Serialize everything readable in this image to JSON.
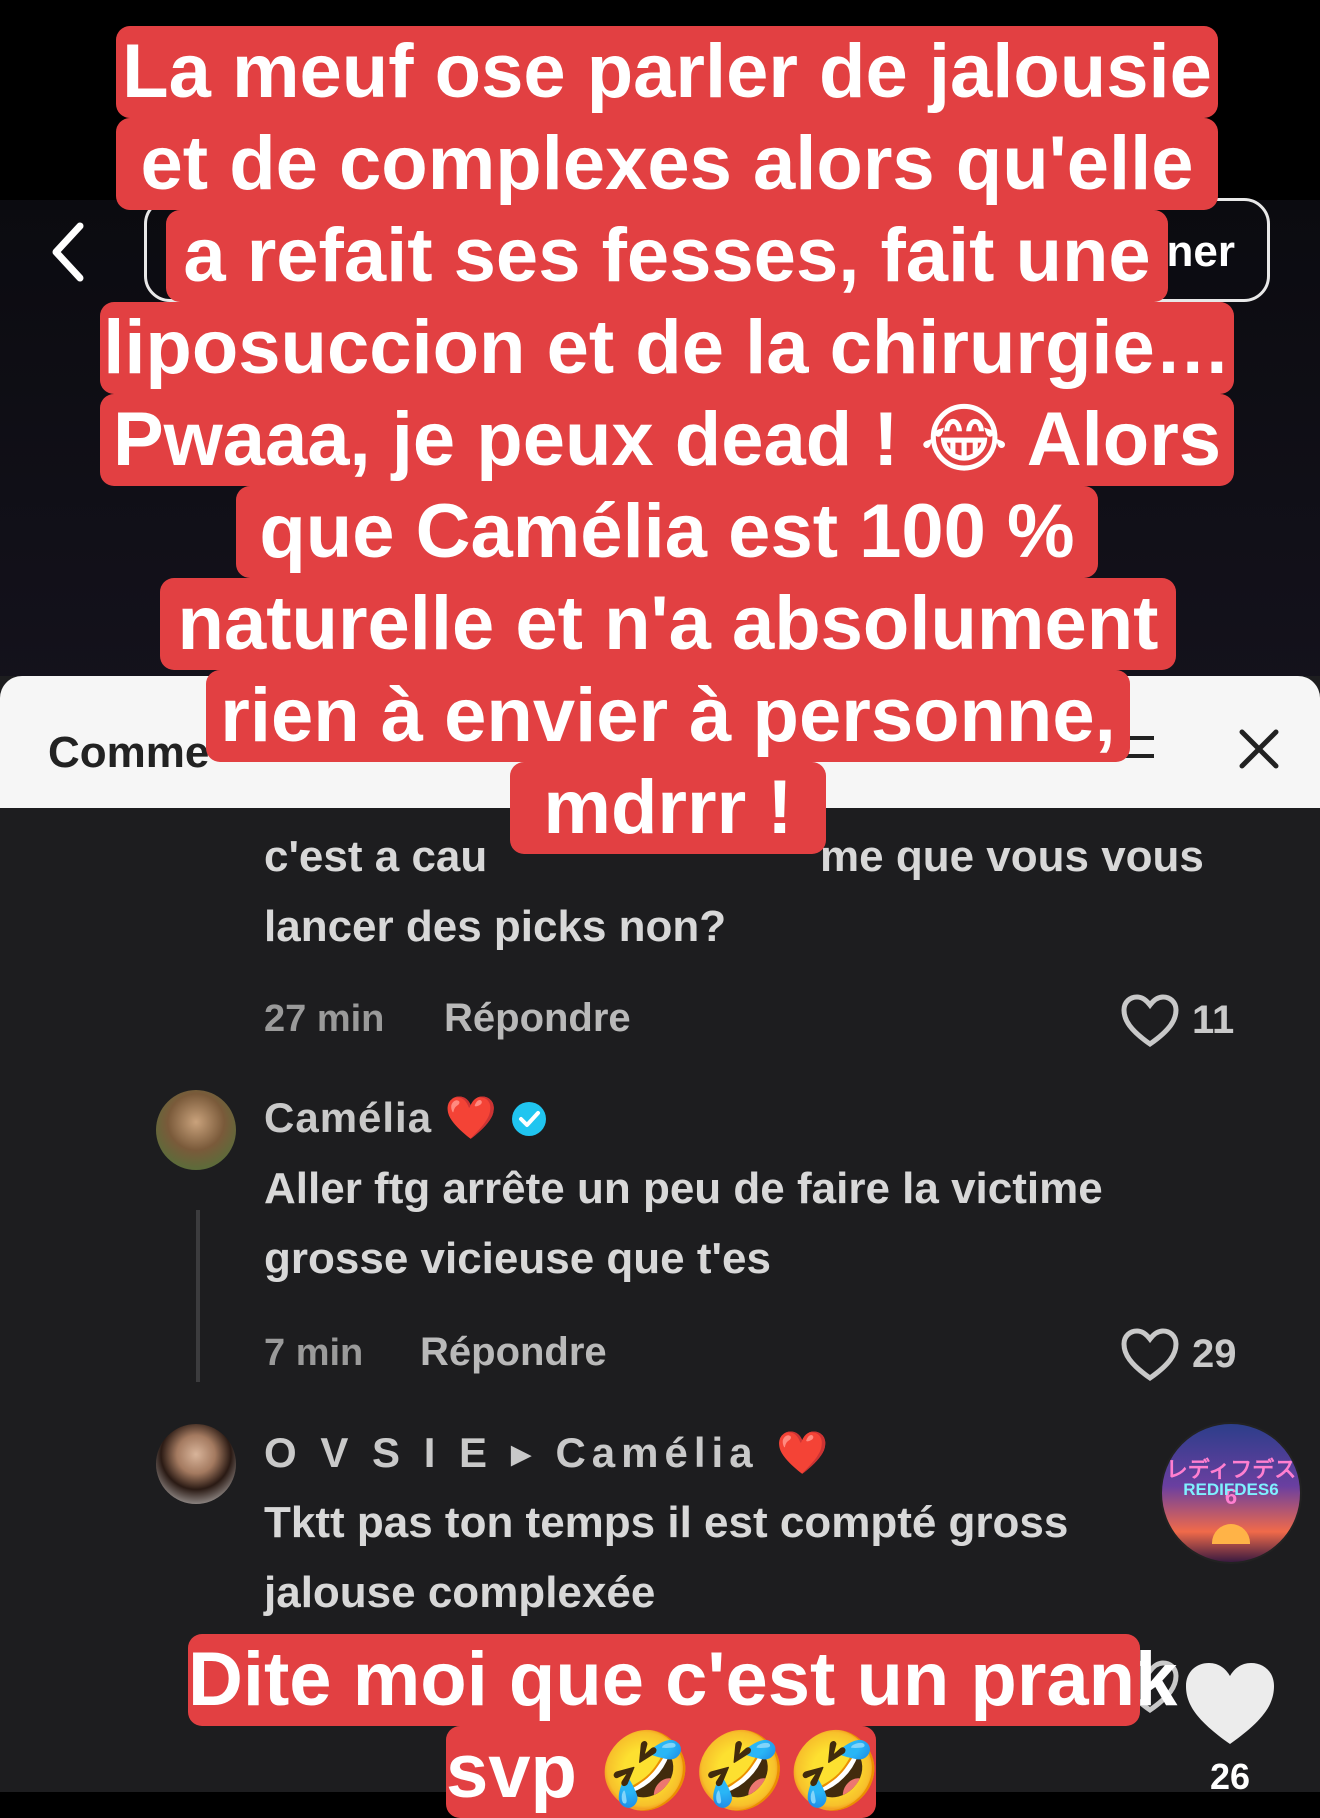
{
  "top_bar": {
    "pill_text": "ner"
  },
  "comments_sheet": {
    "title": "Comme",
    "comments": [
      {
        "text_lines": [
          "c'est a cau",
          "me que vous vous",
          "lancer des picks non?"
        ],
        "time": "27 min",
        "reply_label": "Répondre",
        "likes": "11"
      },
      {
        "username": "Camélia ❤️",
        "text_lines": [
          "Aller ftg arrête un peu de faire la victime",
          "grosse vicieuse que t'es"
        ],
        "time": "7 min",
        "reply_label": "Répondre",
        "likes": "29"
      },
      {
        "username": "O V S I E ▸ Camélia ❤️",
        "text_lines": [
          "Tktt pas ton temps il est compté gross",
          "jalouse complexée"
        ]
      }
    ]
  },
  "overlay_caption_top": [
    "La meuf ose parler de jalousie",
    "et de complexes alors qu'elle",
    "a refait ses fesses, fait une",
    "liposuccion et de la chirurgie…",
    "Pwaaa, je peux dead ! 😂 Alors",
    "que Camélia est 100 %",
    "naturelle et n'a absolument",
    "rien à envier à personne,",
    "mdrrr !"
  ],
  "overlay_caption_bottom": [
    "Dite moi que c'est un prank",
    "svp 🤣🤣🤣"
  ],
  "watermark": {
    "jp": "レディフデス6",
    "en": "REDIFDES6"
  },
  "like_count": "26",
  "colors": {
    "caption_bg": "#e24042",
    "verified": "#20c5f0",
    "heart_red": "#e8242e"
  }
}
